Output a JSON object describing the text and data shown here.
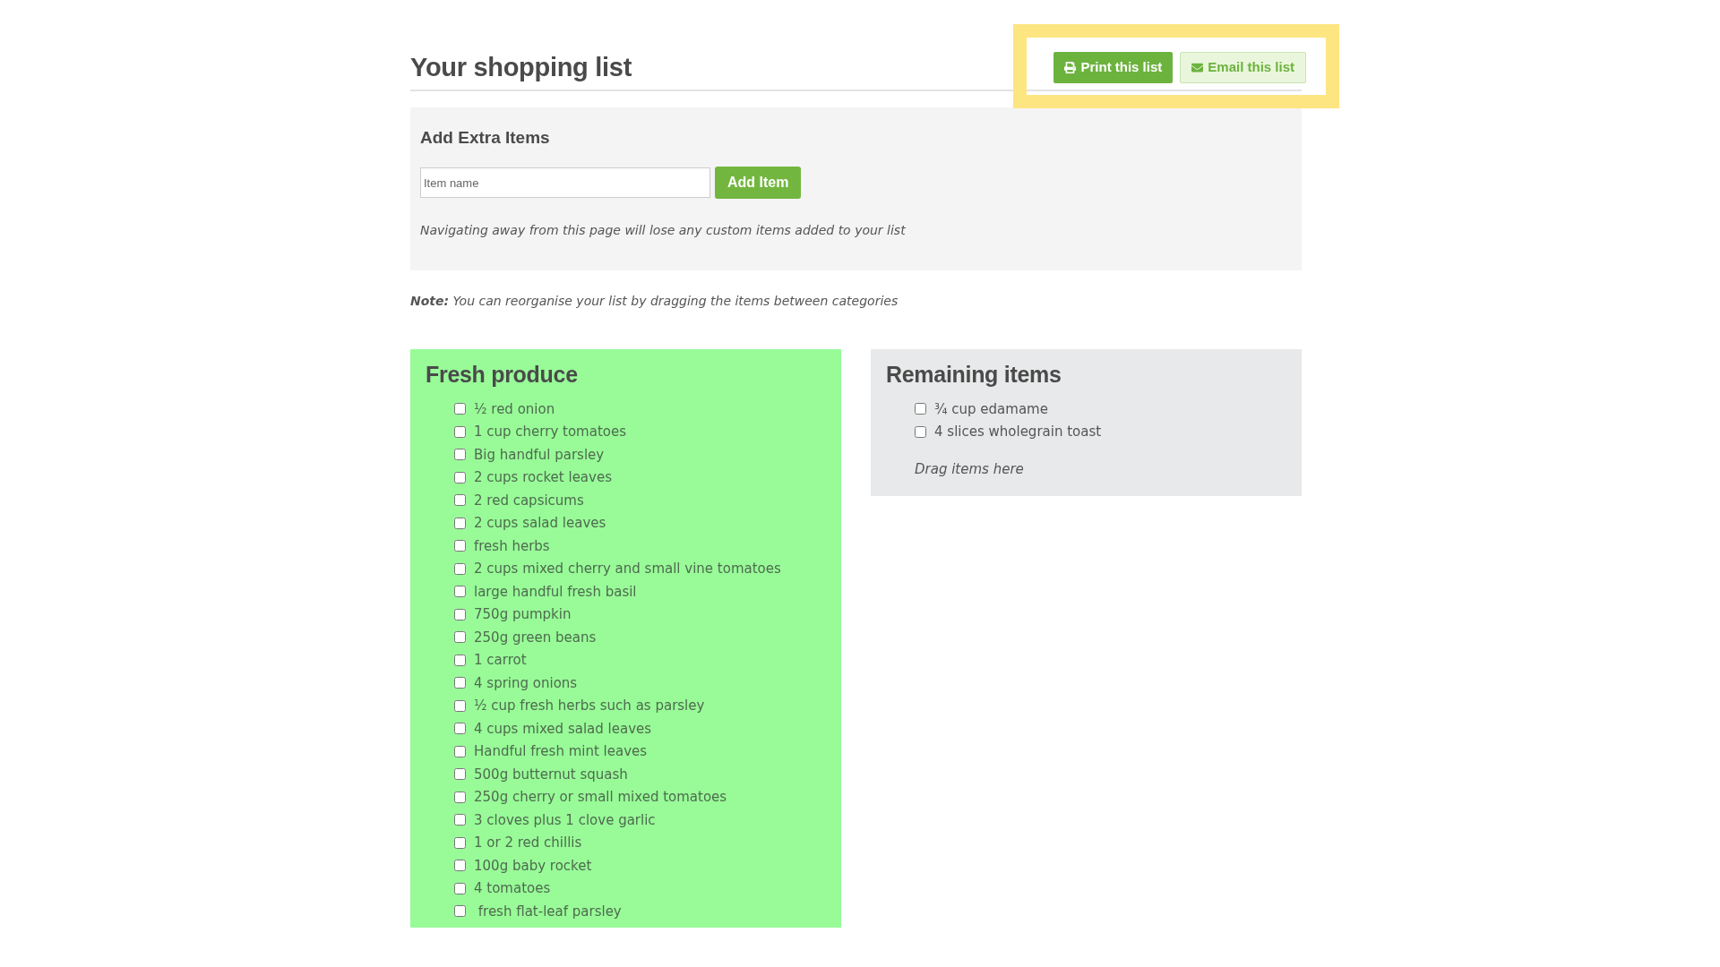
{
  "page_title": "Your shopping list",
  "toolbar": {
    "highlighted": true,
    "buttons": [
      {
        "label": "Print this list",
        "kind": "print"
      },
      {
        "label": "Email this list",
        "kind": "email"
      }
    ]
  },
  "add_items": {
    "heading": "Add Extra Items",
    "input": {
      "placeholder": "Item name"
    },
    "button": "Add Item",
    "warning": "Navigating away from this page will lose any custom items added to your list"
  },
  "note": "**Note:** You can reorganise your list by dragging the items between categories",
  "categories": [
    {
      "title": "Fresh produce",
      "color": "#98fb98",
      "items": [
        {
          "label": "½ red onion",
          "checked": false
        },
        {
          "label": "1 cup cherry tomatoes",
          "checked": false
        },
        {
          "label": "Big handful parsley",
          "checked": false
        },
        {
          "label": "2 cups rocket leaves",
          "checked": false
        },
        {
          "label": "2 red capsicums",
          "checked": false
        },
        {
          "label": "2 cups salad leaves",
          "checked": false
        },
        {
          "label": "fresh herbs",
          "checked": false
        },
        {
          "label": "2 cups mixed cherry and small vine tomatoes",
          "checked": false
        },
        {
          "label": "large handful fresh basil",
          "checked": false
        },
        {
          "label": "750g pumpkin",
          "checked": false
        },
        {
          "label": "250g green beans",
          "checked": false
        },
        {
          "label": "1 carrot",
          "checked": false
        },
        {
          "label": "4 spring onions",
          "checked": false
        },
        {
          "label": "½ cup fresh herbs such as parsley",
          "checked": false
        },
        {
          "label": "4 cups mixed salad leaves",
          "checked": false
        },
        {
          "label": "Handful fresh mint leaves",
          "checked": false
        },
        {
          "label": "500g butternut squash",
          "checked": false
        },
        {
          "label": "250g cherry or small mixed tomatoes",
          "checked": false
        },
        {
          "label": "3 cloves plus 1 clove garlic",
          "checked": false
        },
        {
          "label": "1 or 2 red chillis",
          "checked": false
        },
        {
          "label": "100g baby rocket",
          "checked": false
        },
        {
          "label": "4 tomatoes",
          "checked": false
        },
        {
          "label": " fresh flat-leaf parsley",
          "checked": false
        }
      ]
    },
    {
      "title": "Remaining items",
      "color": "#e8e9ea",
      "items": [
        {
          "label": "¾ cup edamame",
          "checked": false
        },
        {
          "label": "4 slices wholegrain toast",
          "checked": false
        }
      ],
      "drop_hint": "Drag items here"
    }
  ]
}
